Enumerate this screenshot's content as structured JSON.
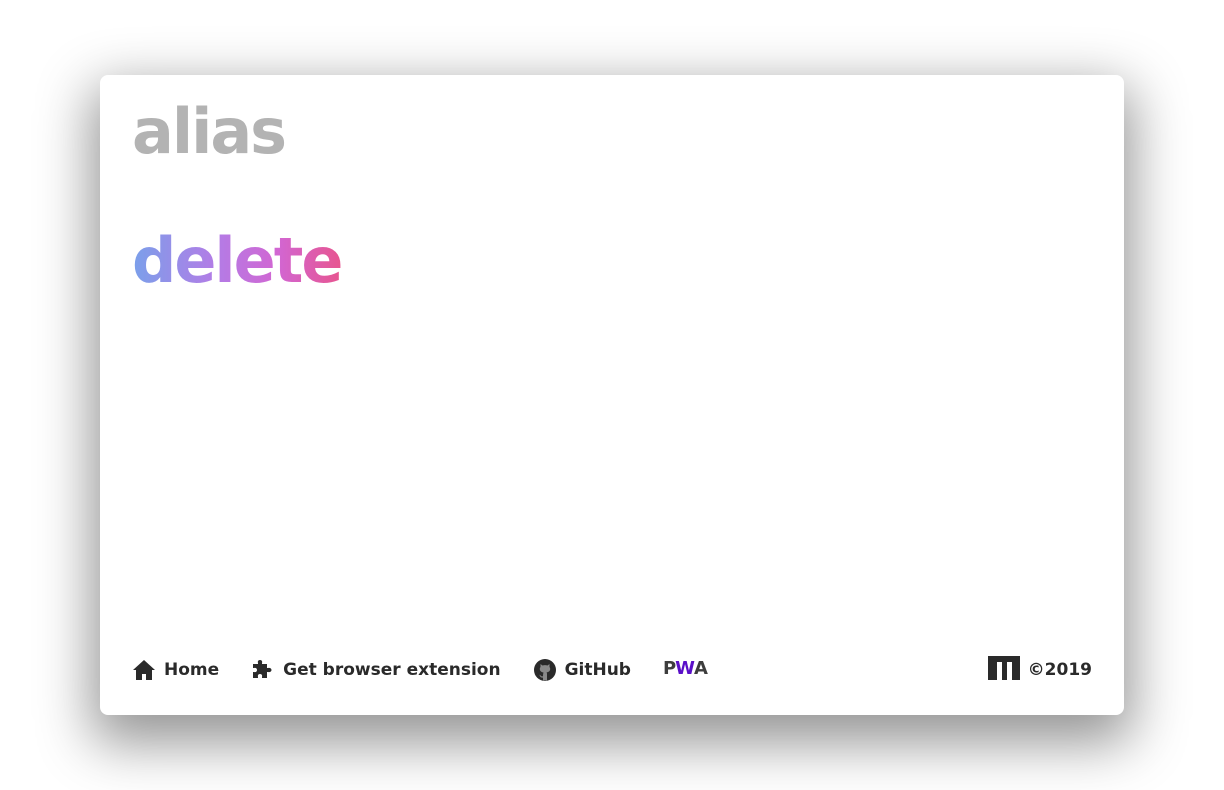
{
  "header": {
    "label": "alias",
    "action": "delete"
  },
  "footer": {
    "links": [
      {
        "label": "Home",
        "icon": "home-icon"
      },
      {
        "label": "Get browser extension",
        "icon": "puzzle-icon"
      },
      {
        "label": "GitHub",
        "icon": "github-icon"
      }
    ],
    "pwa_badge": {
      "p": "P",
      "w": "W",
      "a": "A"
    },
    "copyright": "©2019",
    "logo_icon": "m-logo-icon"
  },
  "colors": {
    "label_gray": "#b3b3b3",
    "gradient_start": "#7aa0ea",
    "gradient_end": "#e75590",
    "pwa_purple": "#5a0fc8",
    "text_dark": "#2a2a2a"
  }
}
